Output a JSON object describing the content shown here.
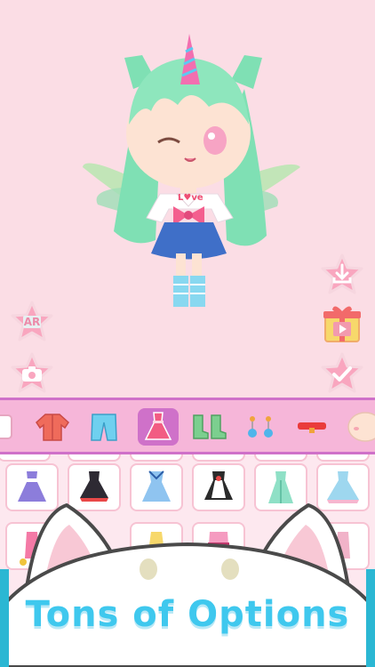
{
  "buttons": {
    "ar_label": "AR"
  },
  "icons": {
    "ar": "ar-star-icon",
    "camera": "camera-star-icon",
    "download": "download-star-icon",
    "gift": "gift-video-star-icon",
    "confirm": "check-star-icon"
  },
  "categories": [
    {
      "name": "partial-item",
      "active": false
    },
    {
      "name": "jacket",
      "active": false
    },
    {
      "name": "pants",
      "active": false
    },
    {
      "name": "dress",
      "active": true
    },
    {
      "name": "socks",
      "active": false
    },
    {
      "name": "earrings",
      "active": false
    },
    {
      "name": "choker",
      "active": false
    },
    {
      "name": "face",
      "active": false
    }
  ],
  "banner": {
    "text": "Tons of Options"
  },
  "colors": {
    "background": "#fbdde5",
    "category_bar": "#f6b6d9",
    "category_active": "#cf71c9",
    "banner": "#3fc8ee",
    "star_button": "#f9a6bf"
  }
}
